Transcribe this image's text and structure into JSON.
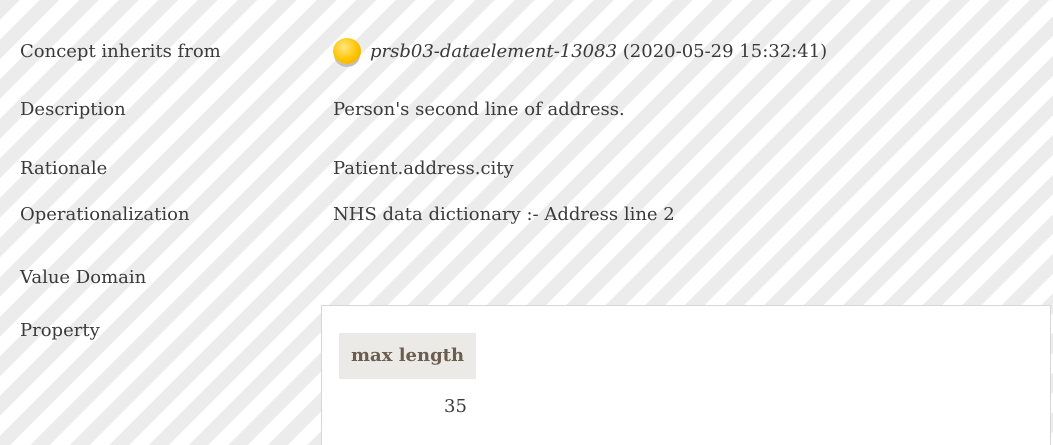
{
  "rows": {
    "inherits": {
      "label": "Concept inherits from",
      "icon": "orb-icon",
      "ref_id": "prsb03-dataelement-13083",
      "ref_date": "(2020-05-29 15:32:41)"
    },
    "description": {
      "label": "Description",
      "value": "Person's second line of address."
    },
    "rationale": {
      "label": "Rationale",
      "value": "Patient.address.city"
    },
    "operationalization": {
      "label": "Operationalization",
      "value": "NHS data dictionary :- Address line 2"
    },
    "value_domain": {
      "label": "Value Domain"
    },
    "property": {
      "label": "Property",
      "header": "max length",
      "value": "35"
    }
  },
  "colors": {
    "orb": "#ffc400",
    "header_bg": "#eceae6",
    "header_text": "#6b5e50"
  }
}
